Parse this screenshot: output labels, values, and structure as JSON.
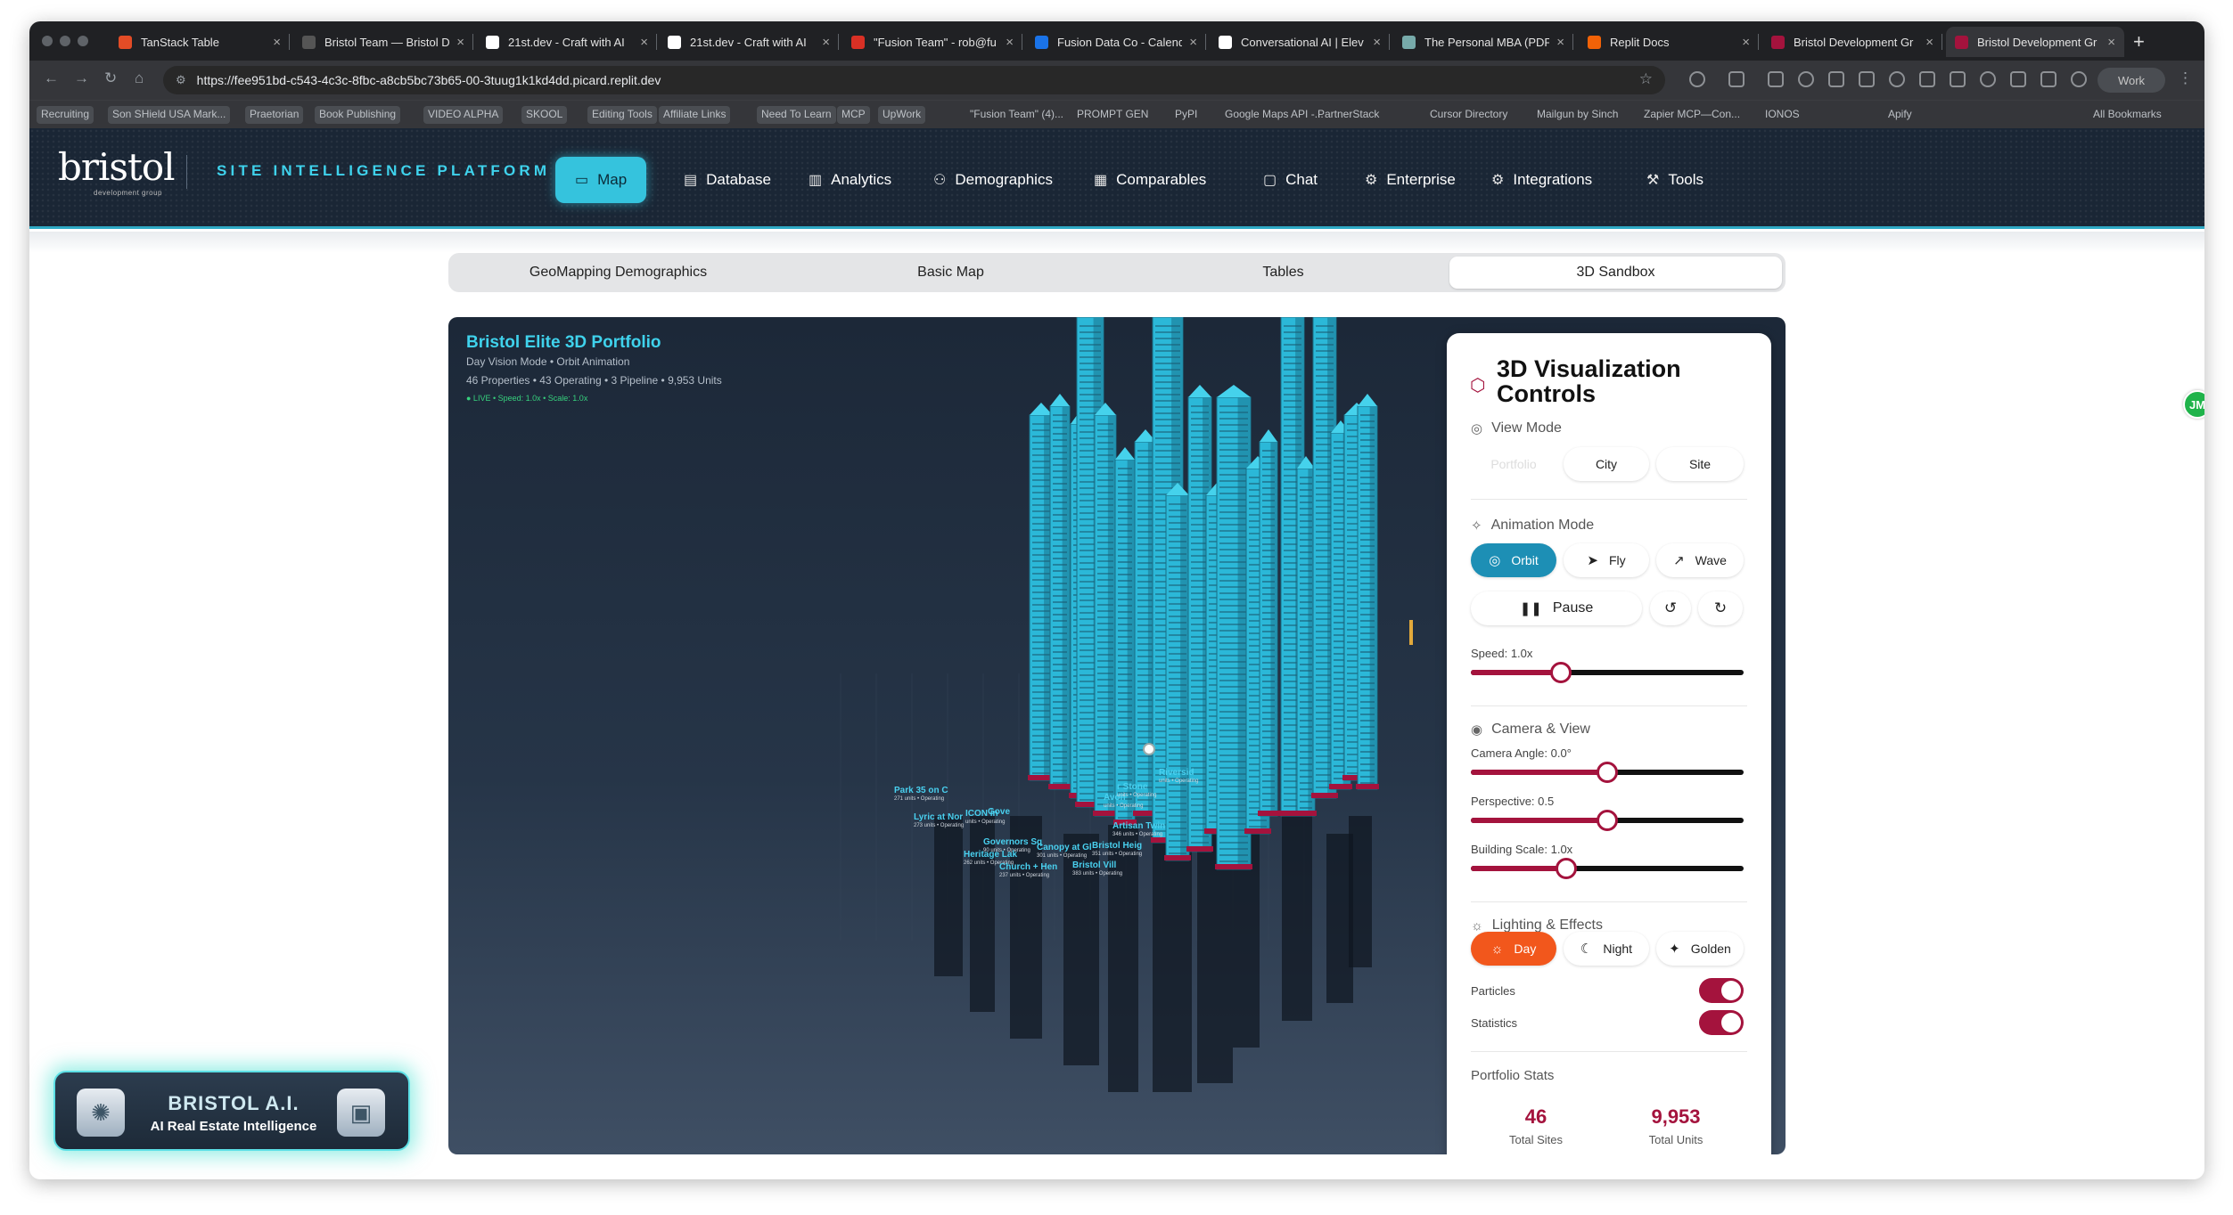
{
  "browser": {
    "tabs": [
      {
        "title": "TanStack Table",
        "fav": "#e34c26"
      },
      {
        "title": "Bristol Team — Bristol D",
        "fav": "#555"
      },
      {
        "title": "21st.dev - Craft with AI",
        "fav": "#fff"
      },
      {
        "title": "21st.dev - Craft with AI",
        "fav": "#fff"
      },
      {
        "title": "\"Fusion Team\" - rob@fu",
        "fav": "#d93025"
      },
      {
        "title": "Fusion Data Co - Calend",
        "fav": "#1a73e8"
      },
      {
        "title": "Conversational AI | Elev",
        "fav": "#fff"
      },
      {
        "title": "The Personal MBA (PDF",
        "fav": "#7aa"
      },
      {
        "title": "Replit Docs",
        "fav": "#f26207"
      },
      {
        "title": "Bristol Development Gr",
        "fav": "#a4133d"
      },
      {
        "title": "Bristol Development Gr",
        "fav": "#a4133d"
      }
    ],
    "url": "https://fee951bd-c543-4c3c-8fbc-a8cb5bc73b65-00-3tuug1k1kd4dd.picard.replit.dev",
    "profile": "Work",
    "bookmarks": [
      "Recruiting",
      "Son SHield USA Mark...",
      "Praetorian",
      "Book Publishing",
      "VIDEO ALPHA",
      "SKOOL",
      "Editing Tools",
      "Affiliate Links",
      "Need To Learn",
      "MCP",
      "UpWork",
      "\"Fusion Team\" (4)...",
      "PROMPT GEN",
      "PyPI",
      "Google Maps API -...",
      "PartnerStack",
      "Cursor Directory",
      "Mailgun by Sinch",
      "Zapier MCP—Con...",
      "IONOS",
      "Apify",
      "All Bookmarks"
    ]
  },
  "header": {
    "logo": "bristol",
    "logo_sub": "development group",
    "tagline": "SITE INTELLIGENCE PLATFORM",
    "nav": [
      {
        "label": "Map",
        "icon": "map-icon"
      },
      {
        "label": "Database",
        "icon": "database-icon"
      },
      {
        "label": "Analytics",
        "icon": "bar-chart-icon"
      },
      {
        "label": "Demographics",
        "icon": "users-icon"
      },
      {
        "label": "Comparables",
        "icon": "building-icon"
      },
      {
        "label": "Chat",
        "icon": "chat-icon"
      },
      {
        "label": "Enterprise",
        "icon": "gear-icon"
      },
      {
        "label": "Integrations",
        "icon": "gear-icon"
      },
      {
        "label": "Tools",
        "icon": "wrench-icon"
      }
    ]
  },
  "subtabs": [
    "GeoMapping Demographics",
    "Basic Map",
    "Tables",
    "3D Sandbox"
  ],
  "scene": {
    "title": "Bristol Elite 3D Portfolio",
    "mode": "Day Vision Mode • Orbit Animation",
    "stats": "46 Properties • 43 Operating • 3 Pipeline • 9,953 Units",
    "live": "● LIVE • Speed: 1.0x • Scale: 1.0x",
    "labels": [
      {
        "name": "Park 35 on C",
        "sub": "271 units • Operating"
      },
      {
        "name": "Lyric at Nor",
        "sub": "273 units • Operating"
      },
      {
        "name": "ICON in",
        "sub": "units • Operating"
      },
      {
        "name": "Gove",
        "sub": ""
      },
      {
        "name": "Governors Sq",
        "sub": "90 units • Operating"
      },
      {
        "name": "Heritage Lak",
        "sub": "262 units • Operating"
      },
      {
        "name": "Canopy at Gl",
        "sub": "301 units • Operating"
      },
      {
        "name": "Church + Hen",
        "sub": "237 units • Operating"
      },
      {
        "name": "Bristol Vill",
        "sub": "383 units • Operating"
      },
      {
        "name": "Bristol Heig",
        "sub": "351 units • Operating"
      },
      {
        "name": "Artisan Twin",
        "sub": "346 units • Operating"
      },
      {
        "name": "Avon",
        "sub": "units • Operating"
      },
      {
        "name": "r Stone",
        "sub": "units • Operating"
      },
      {
        "name": "Riversid",
        "sub": "units • Operating"
      }
    ]
  },
  "controls": {
    "title": "3D Visualization Controls",
    "view_mode": {
      "label": "View Mode",
      "options": [
        "Portfolio",
        "City",
        "Site"
      ]
    },
    "animation": {
      "label": "Animation Mode",
      "options": [
        "Orbit",
        "Fly",
        "Wave"
      ],
      "pause": "Pause"
    },
    "speed": {
      "label": "Speed: 1.0x",
      "value": 0.33
    },
    "camera": {
      "label": "Camera & View",
      "angle": {
        "label": "Camera Angle: 0.0°",
        "value": 0.5
      },
      "perspective": {
        "label": "Perspective: 0.5",
        "value": 0.5
      },
      "scale": {
        "label": "Building Scale: 1.0x",
        "value": 0.35
      }
    },
    "lighting": {
      "label": "Lighting & Effects",
      "options": [
        "Day",
        "Night",
        "Golden"
      ]
    },
    "particles": "Particles",
    "statistics": "Statistics",
    "portfolio": {
      "label": "Portfolio Stats",
      "sites": "46",
      "sites_label": "Total Sites",
      "units": "9,953",
      "units_label": "Total Units"
    }
  },
  "ai_badge": {
    "title": "BRISTOL A.I.",
    "subtitle": "AI Real Estate Intelligence"
  },
  "floating": {
    "badge": "JM"
  }
}
